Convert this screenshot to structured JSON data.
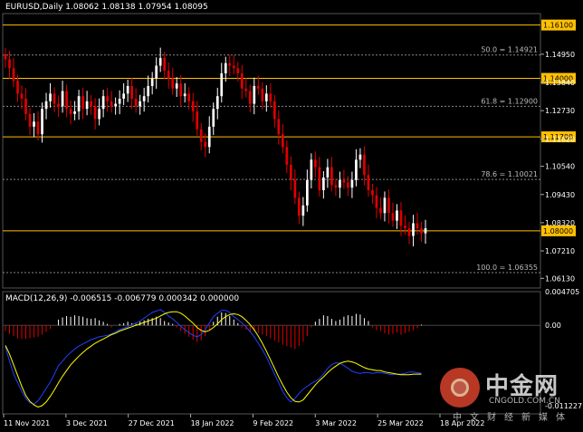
{
  "header": {
    "symbol": "EURUSD,Daily",
    "ohlc": "1.08062 1.08138 1.07954 1.08095"
  },
  "macd_header": {
    "label": "MACD(12,26,9) -0.006515 -0.006779 0.000342 0.000000"
  },
  "watermark": {
    "title": "中金网",
    "url": "CNGOLD.COM.CN",
    "subtitle": "中文财经新媒体"
  },
  "colors": {
    "background": "#000000",
    "bull": "#ffffff",
    "bear": "#e00000",
    "level_line": "#ffc000",
    "fib_line": "#888888",
    "signal_line": "#ffff00",
    "macd_line": "#2040ff",
    "hist_pos": "#ffffff",
    "hist_neg": "#e00000",
    "axis_text": "#ffffff"
  },
  "chart_data": {
    "type": "candlestick",
    "price_axis": {
      "ylim": [
        1.0575,
        1.1655
      ],
      "ticks": [
        "1.14950",
        "1.13840",
        "1.12730",
        "1.11620",
        "1.10540",
        "1.09430",
        "1.08320",
        "1.07210",
        "1.06130"
      ]
    },
    "levels": [
      {
        "value": 1.161,
        "label": "1.16100"
      },
      {
        "value": 1.14,
        "label": "1.14000"
      },
      {
        "value": 1.117,
        "label": "1.11700"
      },
      {
        "value": 1.08,
        "label": "1.08000"
      }
    ],
    "fibonacci": [
      {
        "value": 1.14921,
        "label": "50.0 = 1.14921"
      },
      {
        "value": 1.129,
        "label": "61.8 = 1.12900"
      },
      {
        "value": 1.10021,
        "label": "78.6 = 1.10021"
      },
      {
        "value": 1.06355,
        "label": "100.0 = 1.06355"
      }
    ],
    "x_labels": [
      "11 Nov 2021",
      "3 Dec 2021",
      "27 Dec 2021",
      "18 Jan 2022",
      "9 Feb 2022",
      "3 Mar 2022",
      "25 Mar 2022",
      "18 Apr 2022"
    ],
    "closes": [
      1.1475,
      1.144,
      1.139,
      1.134,
      1.132,
      1.126,
      1.121,
      1.123,
      1.118,
      1.128,
      1.131,
      1.134,
      1.13,
      1.129,
      1.135,
      1.128,
      1.126,
      1.127,
      1.133,
      1.128,
      1.131,
      1.129,
      1.124,
      1.128,
      1.133,
      1.131,
      1.129,
      1.13,
      1.132,
      1.134,
      1.137,
      1.132,
      1.129,
      1.131,
      1.133,
      1.137,
      1.14,
      1.145,
      1.148,
      1.143,
      1.14,
      1.136,
      1.138,
      1.133,
      1.134,
      1.131,
      1.127,
      1.12,
      1.115,
      1.113,
      1.121,
      1.128,
      1.133,
      1.142,
      1.146,
      1.145,
      1.144,
      1.142,
      1.136,
      1.135,
      1.13,
      1.137,
      1.136,
      1.131,
      1.134,
      1.131,
      1.124,
      1.118,
      1.113,
      1.106,
      1.1,
      1.093,
      1.086,
      1.09,
      1.1,
      1.108,
      1.105,
      1.096,
      1.101,
      1.105,
      1.098,
      1.097,
      1.1,
      1.099,
      1.097,
      1.1,
      1.108,
      1.11,
      1.102,
      1.096,
      1.094,
      1.089,
      1.087,
      1.093,
      1.087,
      1.084,
      1.088,
      1.082,
      1.081,
      1.078,
      1.083,
      1.081,
      1.079,
      1.081
    ],
    "macd": {
      "zero_value": "0.00",
      "ylim": [
        -0.01235,
        0.0047
      ],
      "ticks": [
        "0.004705",
        "0.00",
        "-0.011227"
      ],
      "histogram": [
        -0.0008,
        -0.0012,
        -0.0015,
        -0.0018,
        -0.0019,
        -0.0019,
        -0.0018,
        -0.0017,
        -0.0016,
        -0.0013,
        -0.0009,
        -0.0005,
        0,
        0.0008,
        0.0011,
        0.0013,
        0.0012,
        0.0014,
        0.0013,
        0.0012,
        0.001,
        0.0009,
        0.001,
        0.0007,
        0.0005,
        0.0002,
        -0.0003,
        0,
        0.0002,
        0.0003,
        0.0005,
        0.0003,
        0.0002,
        0.0005,
        0.0007,
        0.0009,
        0.001,
        0.0012,
        0.001,
        0.0006,
        0.0004,
        0.0002,
        -0.0003,
        -0.0008,
        -0.0012,
        -0.0016,
        -0.002,
        -0.0023,
        -0.0021,
        -0.0015,
        -0.0006,
        0.0005,
        0.0012,
        0.0018,
        0.0017,
        0.0013,
        0.0008,
        0.0003,
        -0.0003,
        -0.0006,
        -0.0009,
        -0.0008,
        -0.0011,
        -0.0013,
        -0.0015,
        -0.0018,
        -0.0021,
        -0.0024,
        -0.0027,
        -0.0029,
        -0.0031,
        -0.0033,
        -0.0029,
        -0.0023,
        -0.0015,
        -0.0003,
        0.0005,
        0.0009,
        0.0014,
        0.0013,
        0.0009,
        0.0006,
        0.0008,
        0.0012,
        0.0014,
        0.0013,
        0.0016,
        0.0015,
        0.001,
        0.0006,
        -0.0003,
        -0.0007,
        -0.0008,
        -0.0011,
        -0.0013,
        -0.0012,
        -0.001,
        -0.0013,
        -0.0011,
        -0.0009,
        -0.0007,
        -0.0004,
        0.0001,
        0
      ],
      "macd_line": [
        -0.003,
        -0.005,
        -0.0068,
        -0.008,
        -0.0092,
        -0.0102,
        -0.0108,
        -0.011,
        -0.0105,
        -0.0097,
        -0.0088,
        -0.0079,
        -0.0068,
        -0.0056,
        -0.005,
        -0.0043,
        -0.0038,
        -0.0033,
        -0.0029,
        -0.0026,
        -0.0023,
        -0.002,
        -0.0018,
        -0.0016,
        -0.0015,
        -0.0014,
        -0.0012,
        -0.0009,
        -0.0006,
        -0.0004,
        -0.0002,
        0.0001,
        0.0003,
        0.0006,
        0.001,
        0.0014,
        0.0018,
        0.002,
        0.0022,
        0.0018,
        0.0013,
        0.0009,
        0.0004,
        -0.0001,
        -0.0006,
        -0.001,
        -0.0014,
        -0.0016,
        -0.0013,
        -0.0006,
        0.0003,
        0.0012,
        0.0017,
        0.0021,
        0.0021,
        0.0018,
        0.0012,
        0.0008,
        0.0003,
        -0.0002,
        -0.0009,
        -0.0016,
        -0.0025,
        -0.0034,
        -0.0044,
        -0.0056,
        -0.0068,
        -0.008,
        -0.0092,
        -0.0101,
        -0.0107,
        -0.0102,
        -0.0095,
        -0.0089,
        -0.0085,
        -0.0081,
        -0.0078,
        -0.0074,
        -0.0068,
        -0.006,
        -0.0055,
        -0.0052,
        -0.0053,
        -0.0056,
        -0.006,
        -0.0064,
        -0.0066,
        -0.0067,
        -0.0066,
        -0.0066,
        -0.0067,
        -0.0066,
        -0.0066,
        -0.0067,
        -0.0068,
        -0.0069,
        -0.0068,
        -0.0068,
        -0.0067,
        -0.0065,
        -0.0065,
        -0.0066,
        -0.0067
      ],
      "signal_line": [
        -0.0028,
        -0.004,
        -0.0055,
        -0.007,
        -0.0085,
        -0.0098,
        -0.0106,
        -0.0111,
        -0.0114,
        -0.0112,
        -0.0107,
        -0.0099,
        -0.009,
        -0.008,
        -0.0071,
        -0.0063,
        -0.0055,
        -0.0049,
        -0.0043,
        -0.0038,
        -0.0033,
        -0.0029,
        -0.0025,
        -0.0022,
        -0.0019,
        -0.0016,
        -0.0013,
        -0.0011,
        -0.0008,
        -0.0006,
        -0.0004,
        -0.0002,
        0,
        0.0002,
        0.0004,
        0.0006,
        0.0008,
        0.001,
        0.0013,
        0.0016,
        0.0018,
        0.0019,
        0.0019,
        0.0017,
        0.0013,
        0.0008,
        0.0003,
        -0.0003,
        -0.0007,
        -0.0009,
        -0.0007,
        -0.0003,
        0.0002,
        0.0008,
        0.0012,
        0.0015,
        0.0016,
        0.0015,
        0.0012,
        0.0007,
        0.0001,
        -0.0006,
        -0.0015,
        -0.0025,
        -0.0036,
        -0.0048,
        -0.006,
        -0.0072,
        -0.0083,
        -0.0093,
        -0.0101,
        -0.0106,
        -0.0107,
        -0.0104,
        -0.0097,
        -0.009,
        -0.0083,
        -0.0077,
        -0.0072,
        -0.0066,
        -0.0061,
        -0.0057,
        -0.0053,
        -0.0051,
        -0.005,
        -0.0051,
        -0.0053,
        -0.0056,
        -0.0059,
        -0.0061,
        -0.0062,
        -0.0063,
        -0.0063,
        -0.0065,
        -0.0066,
        -0.0067,
        -0.0068,
        -0.0069,
        -0.0069,
        -0.0069,
        -0.0068,
        -0.0068,
        -0.0068
      ]
    }
  }
}
